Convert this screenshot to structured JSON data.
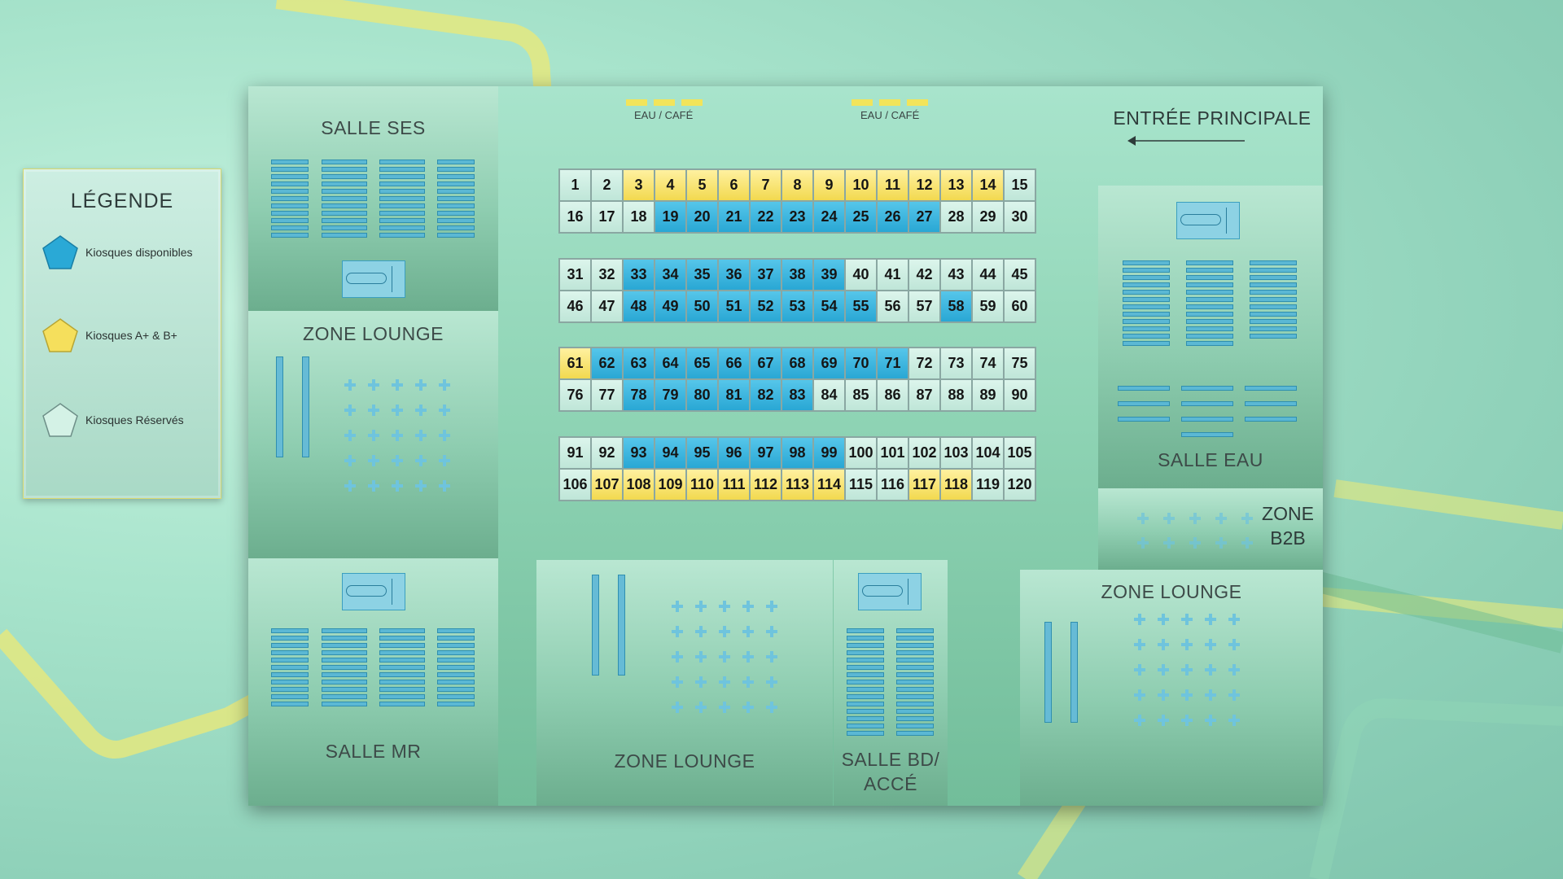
{
  "legend": {
    "title": "LÉGENDE",
    "items": [
      {
        "label": "Kiosques disponibles",
        "color": "#2aa9d6"
      },
      {
        "label": "Kiosques A+ & B+",
        "color": "#f5df5c"
      },
      {
        "label": "Kiosques Réservés",
        "color": "#d4f2e6"
      }
    ]
  },
  "rooms": {
    "salle_ses": "SALLE SES",
    "lounge_left": "ZONE LOUNGE",
    "salle_mr": "SALLE MR",
    "lounge_bottom": "ZONE LOUNGE",
    "salle_bd_line1": "SALLE BD/",
    "salle_bd_line2": "ACCÉ",
    "salle_eau": "SALLE EAU",
    "b2b_line1": "ZONE",
    "b2b_line2": "B2B",
    "lounge_right": "ZONE LOUNGE"
  },
  "entrance": {
    "label": "ENTRÉE PRINCIPALE"
  },
  "water_stations": [
    {
      "label": "EAU / CAFÉ"
    },
    {
      "label": "EAU / CAFÉ"
    }
  ],
  "colors": {
    "available": "#2aa9d6",
    "premium": "#f5df5c",
    "reserved": "#d4f2e6"
  },
  "kiosks": {
    "available": [
      19,
      20,
      21,
      22,
      23,
      24,
      25,
      26,
      27,
      33,
      34,
      35,
      36,
      37,
      38,
      39,
      48,
      49,
      50,
      51,
      52,
      53,
      54,
      55,
      58,
      62,
      63,
      64,
      65,
      66,
      67,
      68,
      69,
      70,
      71,
      78,
      79,
      80,
      81,
      82,
      83,
      93,
      94,
      95,
      96,
      97,
      98,
      99
    ],
    "premium": [
      3,
      4,
      5,
      6,
      7,
      8,
      9,
      10,
      11,
      12,
      13,
      14,
      61,
      107,
      108,
      109,
      110,
      111,
      112,
      113,
      114,
      117,
      118
    ]
  }
}
